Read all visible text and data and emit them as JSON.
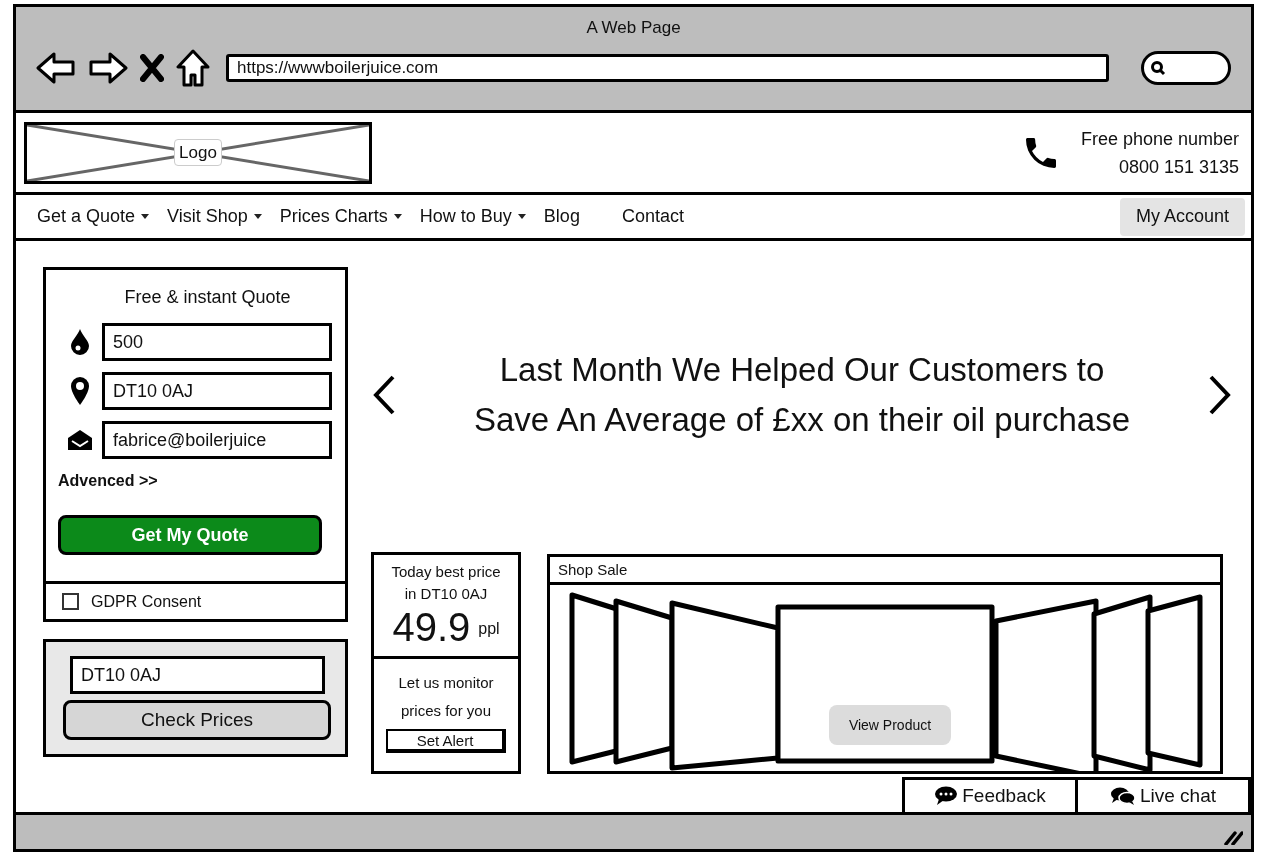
{
  "window": {
    "title": "A Web Page",
    "url": "https://wwwboilerjuice.com"
  },
  "header": {
    "logo": "Logo",
    "phone_label": "Free phone number",
    "phone_number": "0800 151 3135"
  },
  "nav": [
    {
      "label": "Get a Quote",
      "kind": "menu"
    },
    {
      "label": "Visit Shop",
      "kind": "menu"
    },
    {
      "label": "Prices Charts",
      "kind": "menu"
    },
    {
      "label": "How to Buy",
      "kind": "menu"
    },
    {
      "label": "Blog",
      "kind": "link"
    },
    {
      "label": "Contact",
      "kind": "link"
    },
    {
      "label": "My Account",
      "kind": "button"
    }
  ],
  "quote_form": {
    "title": "Free & instant Quote",
    "fields": [
      {
        "kind": "volume",
        "value": "500"
      },
      {
        "kind": "location",
        "value": "DT10 0AJ"
      },
      {
        "kind": "email",
        "value": "fabrice@boilerjuice"
      }
    ],
    "advanced_link": "Advenced >>",
    "submit": "Get My Quote",
    "consent": {
      "label": "GDPR Consent",
      "checked": false
    }
  },
  "price_check": {
    "postcode": "DT10 0AJ",
    "button": "Check Prices"
  },
  "banner": {
    "lines": [
      "Last Month We Helped Our Customers to",
      "Save An Average of £xx on their oil purchase"
    ]
  },
  "best_price": {
    "label": "Today best price in DT10 0AJ",
    "price": "49.9",
    "unit": "ppl",
    "monitor_text": "Let us monitor prices for you",
    "alert_button": "Set Alert"
  },
  "shop_sale": {
    "title": "Shop Sale",
    "button": "View Product"
  },
  "support_tabs": [
    {
      "label": "Feedback",
      "kind": "feedback"
    },
    {
      "label": "Live chat",
      "kind": "chat"
    }
  ]
}
